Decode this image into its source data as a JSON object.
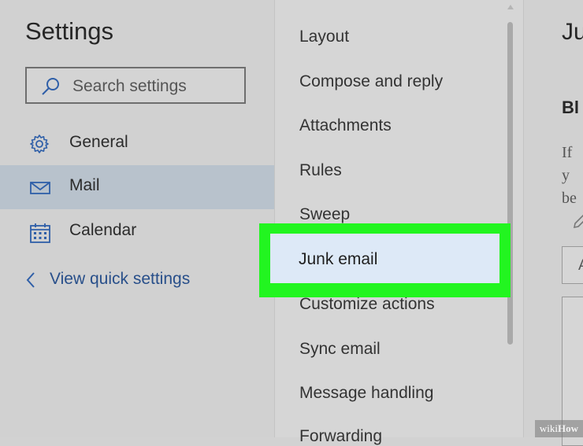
{
  "sidebar": {
    "title": "Settings",
    "search_placeholder": "Search settings",
    "items": [
      {
        "label": "General",
        "icon": "gear-icon"
      },
      {
        "label": "Mail",
        "icon": "mail-icon",
        "selected": true
      },
      {
        "label": "Calendar",
        "icon": "calendar-icon"
      }
    ],
    "quick_settings": "View quick settings",
    "selected_bg": "#b8c2cc",
    "link_color": "#284f8a"
  },
  "mail_menu": {
    "items": [
      "Layout",
      "Compose and reply",
      "Attachments",
      "Rules",
      "Sweep",
      "Junk email",
      "Customize actions",
      "Sync email",
      "Message handling",
      "Forwarding"
    ],
    "selected": "Junk email",
    "highlight_color": "#22f520"
  },
  "right_pane": {
    "title": "Ju",
    "subheading": "Bl",
    "text_lines": [
      "If y",
      "be"
    ],
    "add_box_text": "A"
  },
  "watermark": {
    "prefix": "wiki",
    "brand": "How"
  }
}
